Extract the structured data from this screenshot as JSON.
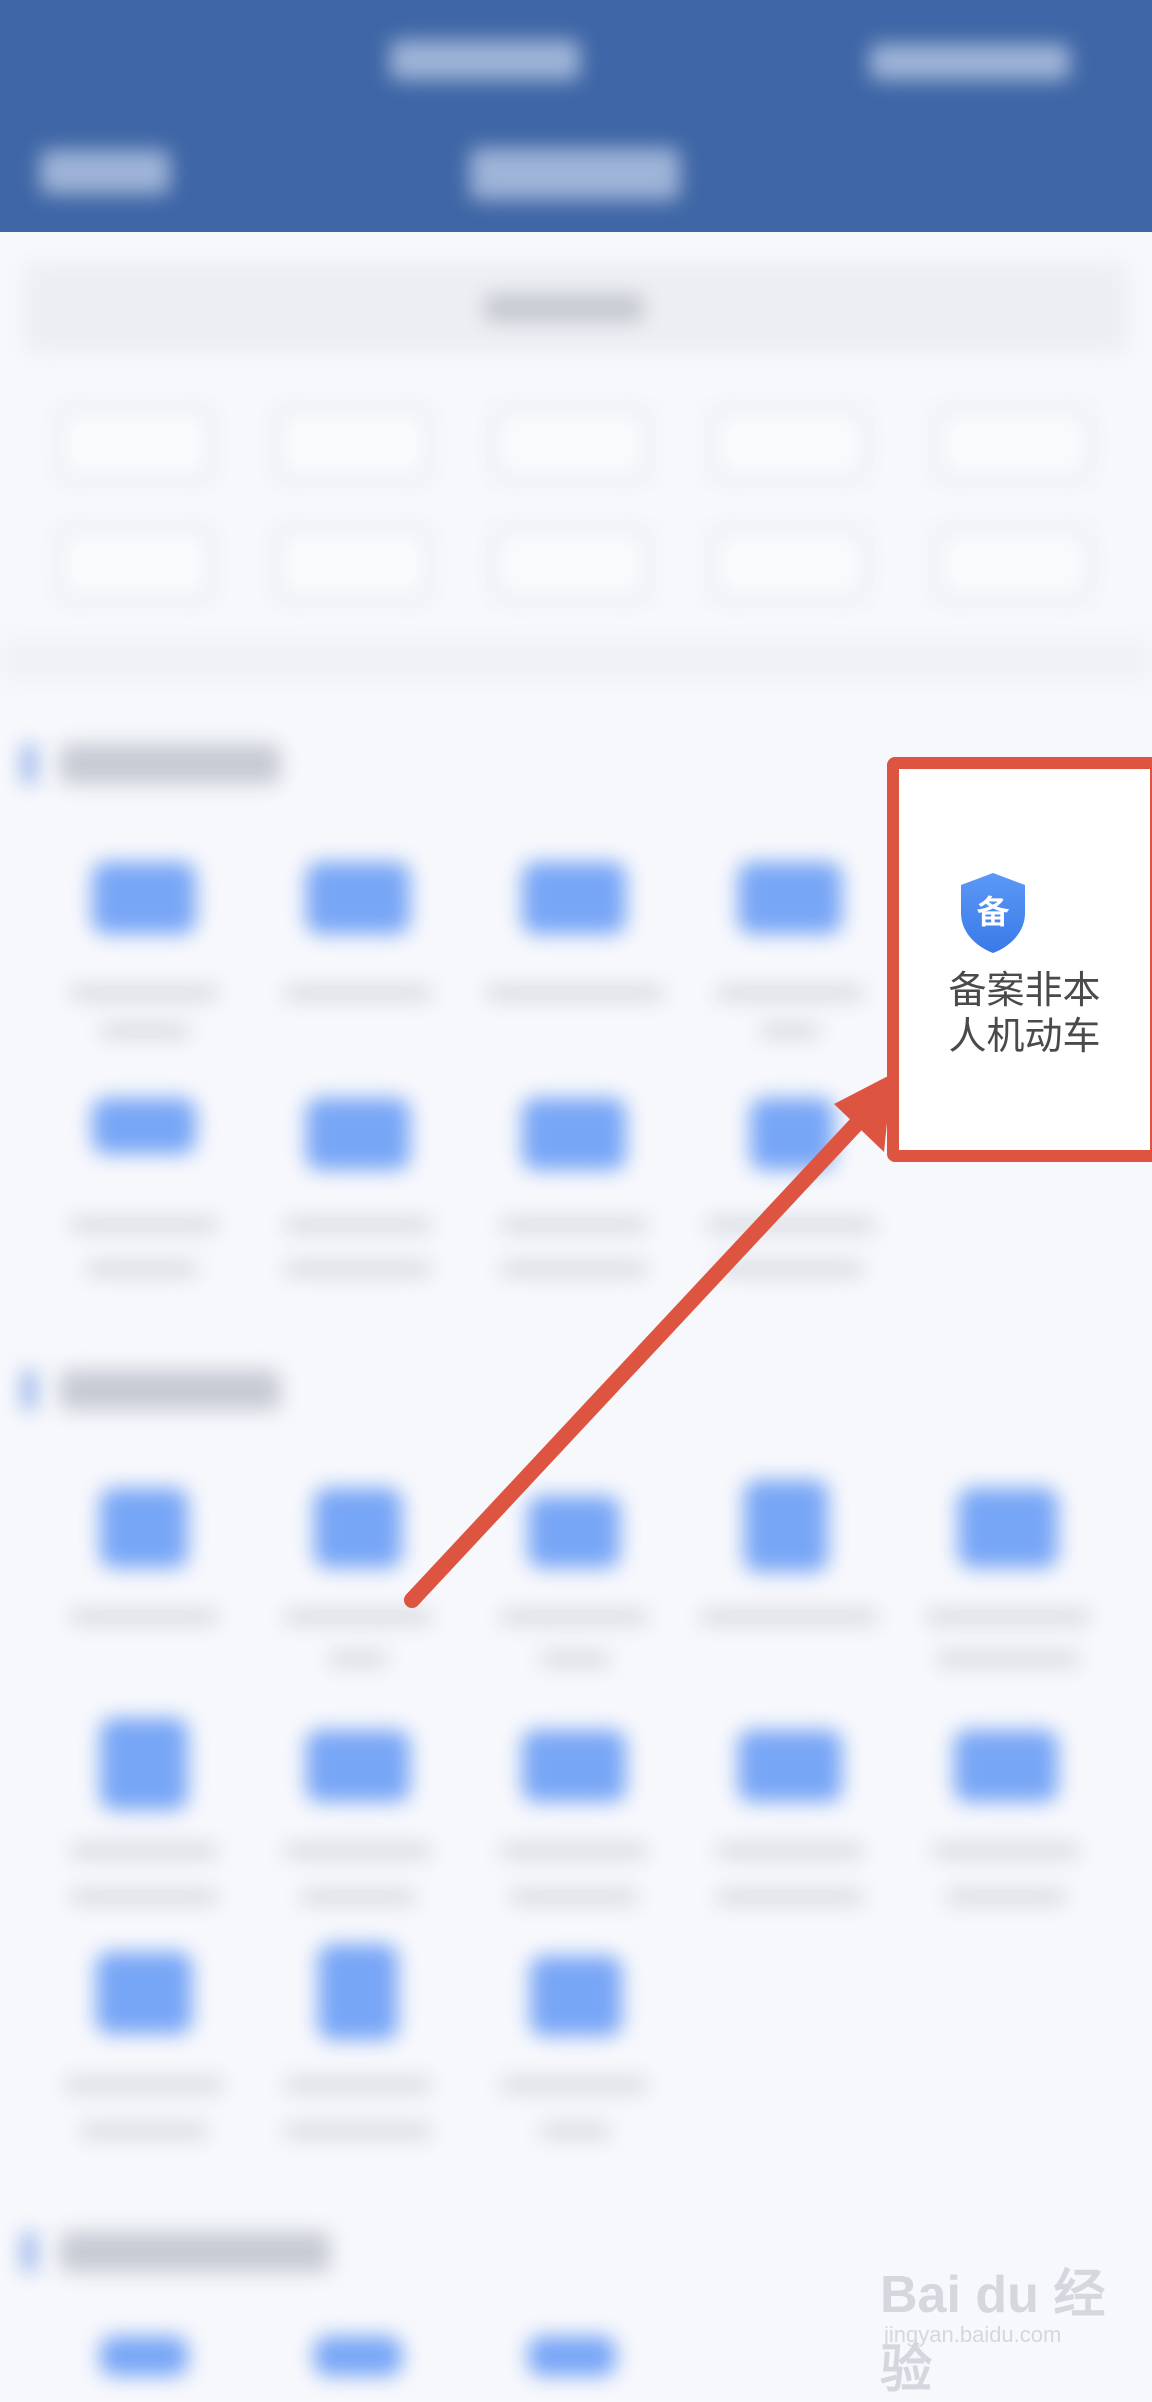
{
  "highlighted_item": {
    "icon": "shield-icon",
    "icon_glyph": "备",
    "label_line1": "备案非本",
    "label_line2": "人机动车"
  },
  "watermark": {
    "brand": "Bai du 经验",
    "site": "jingyan.baidu.com"
  },
  "colors": {
    "header": "#3f66a6",
    "accent": "#4a86f0",
    "highlight_border": "#dd5540",
    "arrow": "#dd5540"
  }
}
